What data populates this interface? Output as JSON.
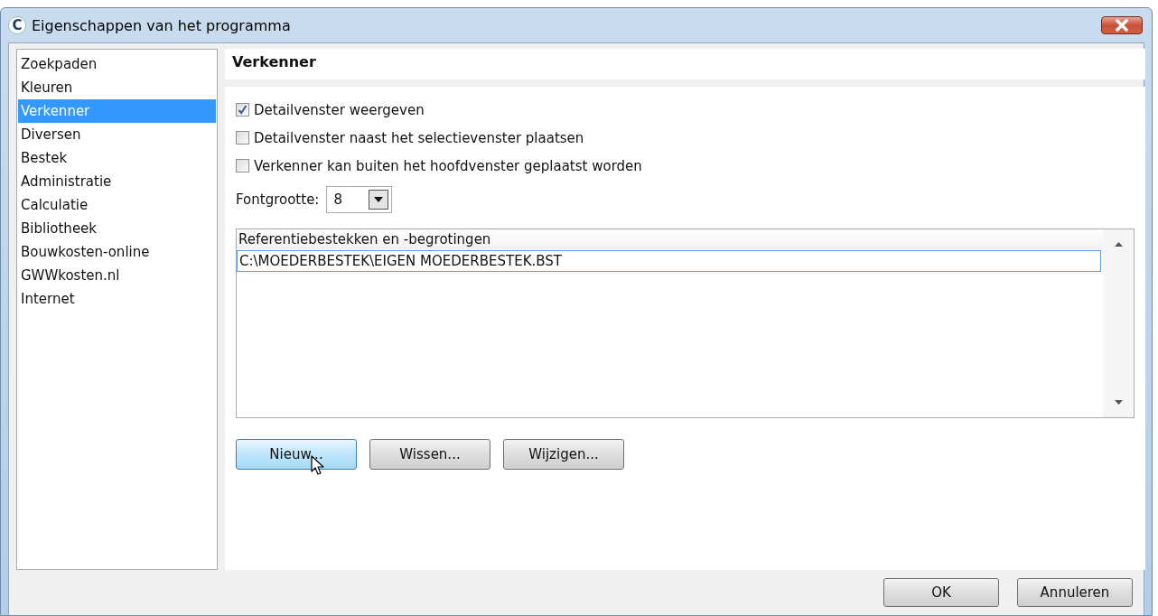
{
  "window": {
    "title": "Eigenschappen van het programma",
    "icon_letter": "C"
  },
  "sidebar": {
    "items": [
      {
        "label": "Zoekpaden",
        "selected": false
      },
      {
        "label": "Kleuren",
        "selected": false
      },
      {
        "label": "Verkenner",
        "selected": true
      },
      {
        "label": "Diversen",
        "selected": false
      },
      {
        "label": "Bestek",
        "selected": false
      },
      {
        "label": "Administratie",
        "selected": false
      },
      {
        "label": "Calculatie",
        "selected": false
      },
      {
        "label": "Bibliotheek",
        "selected": false
      },
      {
        "label": "Bouwkosten-online",
        "selected": false
      },
      {
        "label": "GWWkosten.nl",
        "selected": false
      },
      {
        "label": "Internet",
        "selected": false
      }
    ]
  },
  "panel": {
    "heading": "Verkenner",
    "options": [
      {
        "label": "Detailvenster weergeven",
        "checked": true
      },
      {
        "label": "Detailvenster naast het selectievenster plaatsen",
        "checked": false
      },
      {
        "label": "Verkenner kan buiten het hoofdvenster geplaatst worden",
        "checked": false
      }
    ],
    "font_size": {
      "label": "Fontgrootte:",
      "value": "8"
    },
    "list": {
      "header": "Referentiebestekken en -begrotingen",
      "rows": [
        {
          "text": "C:\\MOEDERBESTEK\\EIGEN MOEDERBESTEK.BST",
          "selected": true
        }
      ]
    },
    "buttons": [
      {
        "label": "Nieuw...",
        "hovered": true
      },
      {
        "label": "Wissen...",
        "hovered": false
      },
      {
        "label": "Wijzigen...",
        "hovered": false
      }
    ]
  },
  "footer": {
    "buttons": [
      {
        "label": "OK"
      },
      {
        "label": "Annuleren"
      }
    ]
  }
}
